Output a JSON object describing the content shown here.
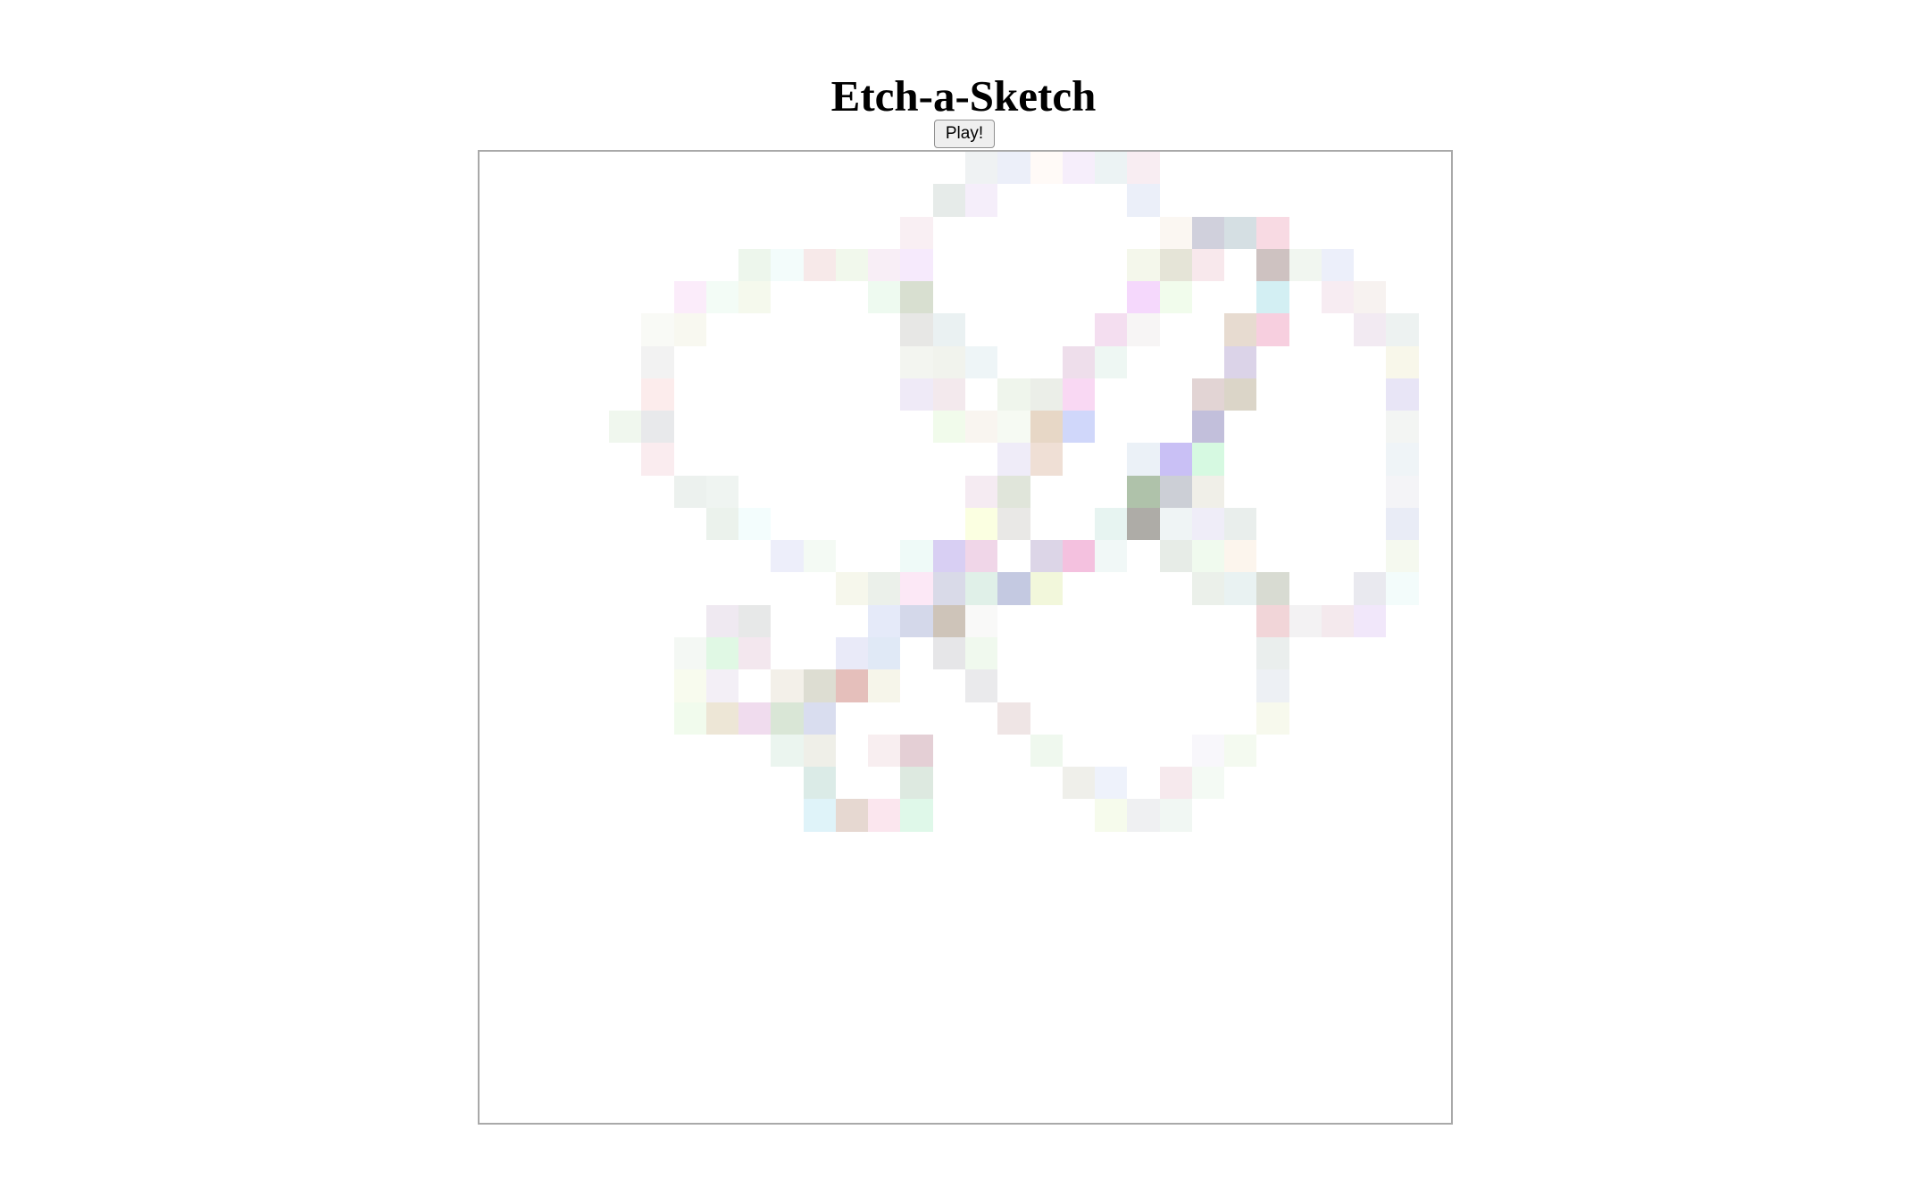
{
  "page": {
    "title": "Etch-a-Sketch",
    "play_label": "Play!"
  },
  "grid": {
    "size": 30,
    "border_color": "#a9a9a9",
    "background": "#ffffff",
    "colored_cells": [
      [
        0,
        15,
        "#eff2f3"
      ],
      [
        0,
        16,
        "#eceff9"
      ],
      [
        0,
        17,
        "#fffaf7"
      ],
      [
        0,
        18,
        "#f6eefb"
      ],
      [
        0,
        19,
        "#ecf3f4"
      ],
      [
        0,
        20,
        "#f8edf2"
      ],
      [
        1,
        14,
        "#e6ebe9"
      ],
      [
        1,
        15,
        "#f5eefa"
      ],
      [
        1,
        20,
        "#ebeff9"
      ],
      [
        2,
        13,
        "#f9eff3"
      ],
      [
        2,
        21,
        "#fbf7f2"
      ],
      [
        2,
        22,
        "#d0d0dc"
      ],
      [
        2,
        23,
        "#d5dfe3"
      ],
      [
        2,
        24,
        "#f8dae3"
      ],
      [
        3,
        8,
        "#edf6ec"
      ],
      [
        3,
        9,
        "#f3fcfb"
      ],
      [
        3,
        10,
        "#f7e9e9"
      ],
      [
        3,
        11,
        "#f1f8ec"
      ],
      [
        3,
        12,
        "#f8eef6"
      ],
      [
        3,
        13,
        "#f6eafc"
      ],
      [
        3,
        20,
        "#f4f7eb"
      ],
      [
        3,
        21,
        "#e5e4d7"
      ],
      [
        3,
        22,
        "#f8e8ec"
      ],
      [
        3,
        24,
        "#cec2c1"
      ],
      [
        3,
        25,
        "#f1f6f0"
      ],
      [
        3,
        26,
        "#eceffa"
      ],
      [
        4,
        6,
        "#fbecfa"
      ],
      [
        4,
        7,
        "#f3fcf6"
      ],
      [
        4,
        8,
        "#f5f9ed"
      ],
      [
        4,
        12,
        "#eefaf0"
      ],
      [
        4,
        13,
        "#d8dfd0"
      ],
      [
        4,
        20,
        "#f5d8fc"
      ],
      [
        4,
        21,
        "#f1fcec"
      ],
      [
        4,
        24,
        "#d3eff3"
      ],
      [
        4,
        26,
        "#f7ecf2"
      ],
      [
        4,
        27,
        "#f7f2f0"
      ],
      [
        5,
        5,
        "#f9faf6"
      ],
      [
        5,
        6,
        "#f8f8f0"
      ],
      [
        5,
        13,
        "#e7e7e5"
      ],
      [
        5,
        14,
        "#eaf1f2"
      ],
      [
        5,
        19,
        "#f4def0"
      ],
      [
        5,
        20,
        "#f7f5f5"
      ],
      [
        5,
        23,
        "#e7dbd0"
      ],
      [
        5,
        24,
        "#f7cfdf"
      ],
      [
        5,
        27,
        "#f2eaf2"
      ],
      [
        5,
        28,
        "#edf2f1"
      ],
      [
        6,
        5,
        "#f2f2f2"
      ],
      [
        6,
        13,
        "#f3f5f0"
      ],
      [
        6,
        14,
        "#f1f3ed"
      ],
      [
        6,
        15,
        "#eef5f7"
      ],
      [
        6,
        18,
        "#eedeeb"
      ],
      [
        6,
        19,
        "#eef7f3"
      ],
      [
        6,
        23,
        "#dbd3e8"
      ],
      [
        6,
        28,
        "#f8f7ea"
      ],
      [
        7,
        5,
        "#fcecec"
      ],
      [
        7,
        13,
        "#efeaf7"
      ],
      [
        7,
        14,
        "#f3e9ed"
      ],
      [
        7,
        16,
        "#eff5ec"
      ],
      [
        7,
        17,
        "#ebeee8"
      ],
      [
        7,
        18,
        "#f9d8f3"
      ],
      [
        7,
        22,
        "#e2d4d4"
      ],
      [
        7,
        23,
        "#dbd5c8"
      ],
      [
        7,
        28,
        "#e8e5f6"
      ],
      [
        8,
        4,
        "#f0f7ee"
      ],
      [
        8,
        5,
        "#e8e9eb"
      ],
      [
        8,
        14,
        "#f1fbeb"
      ],
      [
        8,
        15,
        "#f9f5f0"
      ],
      [
        8,
        16,
        "#f6faf3"
      ],
      [
        8,
        17,
        "#e7d7c6"
      ],
      [
        8,
        18,
        "#d0d7fa"
      ],
      [
        8,
        22,
        "#c2bfdb"
      ],
      [
        8,
        28,
        "#f3f5f3"
      ],
      [
        9,
        5,
        "#faecef"
      ],
      [
        9,
        16,
        "#efecf8"
      ],
      [
        9,
        17,
        "#efdfd5"
      ],
      [
        9,
        20,
        "#ebf1f7"
      ],
      [
        9,
        21,
        "#c9c0f5"
      ],
      [
        9,
        22,
        "#d6f9e1"
      ],
      [
        9,
        28,
        "#eff4f7"
      ],
      [
        10,
        6,
        "#ecf1ee"
      ],
      [
        10,
        7,
        "#eff4f1"
      ],
      [
        10,
        15,
        "#f5ebf2"
      ],
      [
        10,
        16,
        "#e0e5da"
      ],
      [
        10,
        20,
        "#afc2aa"
      ],
      [
        10,
        21,
        "#cccfd6"
      ],
      [
        10,
        22,
        "#f0efe8"
      ],
      [
        10,
        28,
        "#f4f4f7"
      ],
      [
        11,
        7,
        "#ebf2ec"
      ],
      [
        11,
        8,
        "#f3fdfd"
      ],
      [
        11,
        15,
        "#fbffe1"
      ],
      [
        11,
        16,
        "#e9e8e6"
      ],
      [
        11,
        19,
        "#e7f4f1"
      ],
      [
        11,
        20,
        "#aeaca7"
      ],
      [
        11,
        21,
        "#eff4f5"
      ],
      [
        11,
        22,
        "#efedf8"
      ],
      [
        11,
        23,
        "#e9eeec"
      ],
      [
        11,
        28,
        "#e9ecf6"
      ],
      [
        12,
        9,
        "#edeefa"
      ],
      [
        12,
        10,
        "#f4faf4"
      ],
      [
        12,
        13,
        "#effaf8"
      ],
      [
        12,
        14,
        "#d8cff3"
      ],
      [
        12,
        15,
        "#f0d6e8"
      ],
      [
        12,
        17,
        "#dcd5e7"
      ],
      [
        12,
        18,
        "#f4c1df"
      ],
      [
        12,
        19,
        "#f1f8f7"
      ],
      [
        12,
        21,
        "#e7ece7"
      ],
      [
        12,
        22,
        "#f0faee"
      ],
      [
        12,
        23,
        "#fcf5ed"
      ],
      [
        12,
        28,
        "#f5f9ef"
      ],
      [
        13,
        11,
        "#f6f7ec"
      ],
      [
        13,
        12,
        "#ebf0ea"
      ],
      [
        13,
        13,
        "#fce8f6"
      ],
      [
        13,
        14,
        "#d9dae8"
      ],
      [
        13,
        15,
        "#e0f0e8"
      ],
      [
        13,
        16,
        "#c4c9e1"
      ],
      [
        13,
        17,
        "#f2f7db"
      ],
      [
        13,
        22,
        "#ebf0ea"
      ],
      [
        13,
        23,
        "#e9f2f2"
      ],
      [
        13,
        24,
        "#d8dbd2"
      ],
      [
        13,
        27,
        "#e9e9ef"
      ],
      [
        13,
        28,
        "#f3fcfb"
      ],
      [
        14,
        7,
        "#efe9f1"
      ],
      [
        14,
        8,
        "#e7e8e8"
      ],
      [
        14,
        12,
        "#e5eaf9"
      ],
      [
        14,
        13,
        "#d4d8ea"
      ],
      [
        14,
        14,
        "#cec4b9"
      ],
      [
        14,
        15,
        "#f9f9f8"
      ],
      [
        14,
        24,
        "#f1d5d8"
      ],
      [
        14,
        25,
        "#f3f2f3"
      ],
      [
        14,
        26,
        "#f4e9ed"
      ],
      [
        14,
        27,
        "#f1e7fa"
      ],
      [
        15,
        6,
        "#f4f8f4"
      ],
      [
        15,
        7,
        "#e0f8e4"
      ],
      [
        15,
        8,
        "#f3e7ee"
      ],
      [
        15,
        11,
        "#e9eaf8"
      ],
      [
        15,
        12,
        "#e0e9f6"
      ],
      [
        15,
        14,
        "#e6e6e8"
      ],
      [
        15,
        15,
        "#f0f9ee"
      ],
      [
        15,
        24,
        "#eaeeed"
      ],
      [
        16,
        6,
        "#f8fbee"
      ],
      [
        16,
        7,
        "#f3eff6"
      ],
      [
        16,
        9,
        "#f3f0e9"
      ],
      [
        16,
        10,
        "#ddddd2"
      ],
      [
        16,
        11,
        "#e5bfbb"
      ],
      [
        16,
        12,
        "#f6f5ea"
      ],
      [
        16,
        15,
        "#eaeaec"
      ],
      [
        16,
        24,
        "#edf0f4"
      ],
      [
        17,
        6,
        "#f1fbed"
      ],
      [
        17,
        7,
        "#ede6d6"
      ],
      [
        17,
        8,
        "#f0dcee"
      ],
      [
        17,
        9,
        "#d9e6d6"
      ],
      [
        17,
        10,
        "#d9ddef"
      ],
      [
        17,
        16,
        "#efe5e5"
      ],
      [
        17,
        24,
        "#f7f9ed"
      ],
      [
        18,
        9,
        "#ebf5ef"
      ],
      [
        18,
        10,
        "#efefe8"
      ],
      [
        18,
        12,
        "#f8eef0"
      ],
      [
        18,
        13,
        "#e4cfd5"
      ],
      [
        18,
        17,
        "#eff8ee"
      ],
      [
        18,
        22,
        "#f8f7fb"
      ],
      [
        18,
        23,
        "#f4faf0"
      ],
      [
        19,
        10,
        "#dbebe7"
      ],
      [
        19,
        13,
        "#dde9e0"
      ],
      [
        19,
        18,
        "#efefea"
      ],
      [
        19,
        19,
        "#eef2fb"
      ],
      [
        19,
        21,
        "#f6e9ed"
      ],
      [
        19,
        22,
        "#f4faf4"
      ],
      [
        20,
        10,
        "#dff3f9"
      ],
      [
        20,
        11,
        "#e6d8d1"
      ],
      [
        20,
        12,
        "#fbe6ee"
      ],
      [
        20,
        13,
        "#dff8e9"
      ],
      [
        20,
        19,
        "#f6fbec"
      ],
      [
        20,
        20,
        "#eff0f2"
      ],
      [
        20,
        21,
        "#f1f7f3"
      ]
    ]
  }
}
